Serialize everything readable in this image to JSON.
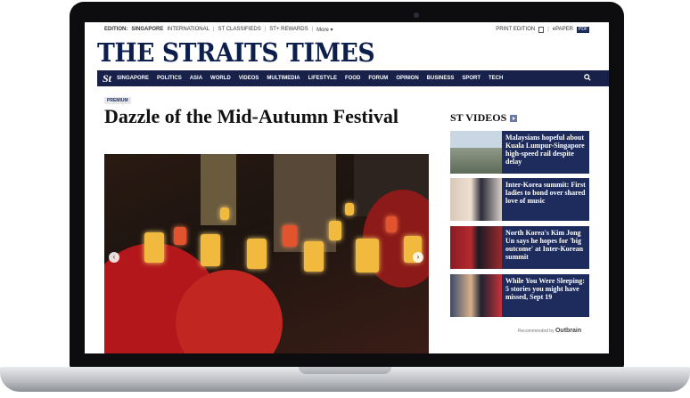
{
  "utility": {
    "edition_label": "EDITION:",
    "edition_active": "SINGAPORE",
    "edition_other": "INTERNATIONAL",
    "classifieds": "ST CLASSIFIEDS",
    "rewards": "ST+ REWARDS",
    "more": "More ▾",
    "print_edition": "PRINT EDITION",
    "epaper": "ePAPER",
    "pdf": "PDF"
  },
  "masthead": "THE STRAITS TIMES",
  "nav": {
    "logo": "St",
    "items": [
      "SINGAPORE",
      "POLITICS",
      "ASIA",
      "WORLD",
      "VIDEOS",
      "MULTIMEDIA",
      "LIFESTYLE",
      "FOOD",
      "FORUM",
      "OPINION",
      "BUSINESS",
      "SPORT",
      "TECH"
    ],
    "search_icon": "search-icon"
  },
  "article": {
    "badge": "PREMIUM",
    "headline": "Dazzle of the Mid-Autumn Festival",
    "prev_icon": "chevron-left-icon",
    "next_icon": "chevron-right-icon"
  },
  "sidebar": {
    "heading": "ST VIDEOS",
    "videos": [
      {
        "title": "Malaysians hopeful about Kuala Lumpur-Singapore high-speed rail despite delay"
      },
      {
        "title": "Inter-Korea summit: First ladies to bond over shared love of music"
      },
      {
        "title": "North Korea's Kim Jong Un says he hopes for 'big outcome' at Inter-Korean summit"
      },
      {
        "title": "While You Were Sleeping: 5 stories you might have missed, Sept 19"
      }
    ],
    "recommended_by": "Recommended by",
    "outbrain": "Outbrain"
  }
}
